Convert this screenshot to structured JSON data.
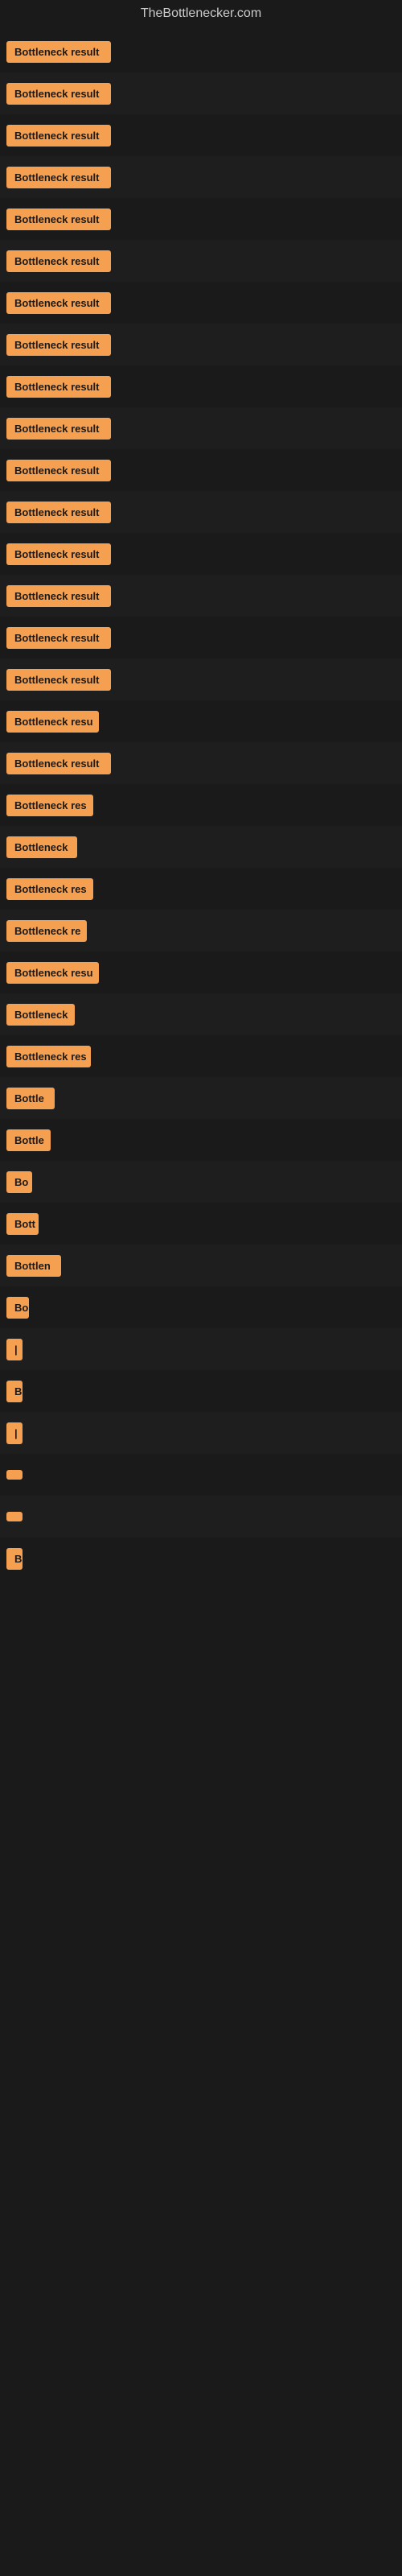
{
  "site": {
    "title": "TheBottlenecker.com"
  },
  "results": [
    {
      "label": "Bottleneck result",
      "width": 130
    },
    {
      "label": "Bottleneck result",
      "width": 130
    },
    {
      "label": "Bottleneck result",
      "width": 130
    },
    {
      "label": "Bottleneck result",
      "width": 130
    },
    {
      "label": "Bottleneck result",
      "width": 130
    },
    {
      "label": "Bottleneck result",
      "width": 130
    },
    {
      "label": "Bottleneck result",
      "width": 130
    },
    {
      "label": "Bottleneck result",
      "width": 130
    },
    {
      "label": "Bottleneck result",
      "width": 130
    },
    {
      "label": "Bottleneck result",
      "width": 130
    },
    {
      "label": "Bottleneck result",
      "width": 130
    },
    {
      "label": "Bottleneck result",
      "width": 130
    },
    {
      "label": "Bottleneck result",
      "width": 130
    },
    {
      "label": "Bottleneck result",
      "width": 130
    },
    {
      "label": "Bottleneck result",
      "width": 130
    },
    {
      "label": "Bottleneck result",
      "width": 130
    },
    {
      "label": "Bottleneck resu",
      "width": 115
    },
    {
      "label": "Bottleneck result",
      "width": 130
    },
    {
      "label": "Bottleneck res",
      "width": 108
    },
    {
      "label": "Bottleneck",
      "width": 88
    },
    {
      "label": "Bottleneck res",
      "width": 108
    },
    {
      "label": "Bottleneck re",
      "width": 100
    },
    {
      "label": "Bottleneck resu",
      "width": 115
    },
    {
      "label": "Bottleneck",
      "width": 85
    },
    {
      "label": "Bottleneck res",
      "width": 105
    },
    {
      "label": "Bottle",
      "width": 60
    },
    {
      "label": "Bottle",
      "width": 55
    },
    {
      "label": "Bo",
      "width": 32
    },
    {
      "label": "Bott",
      "width": 40
    },
    {
      "label": "Bottlen",
      "width": 68
    },
    {
      "label": "Bo",
      "width": 28
    },
    {
      "label": "|",
      "width": 10
    },
    {
      "label": "B",
      "width": 14
    },
    {
      "label": "|",
      "width": 10
    },
    {
      "label": "",
      "width": 10
    },
    {
      "label": "",
      "width": 10
    },
    {
      "label": "B",
      "width": 14
    }
  ]
}
